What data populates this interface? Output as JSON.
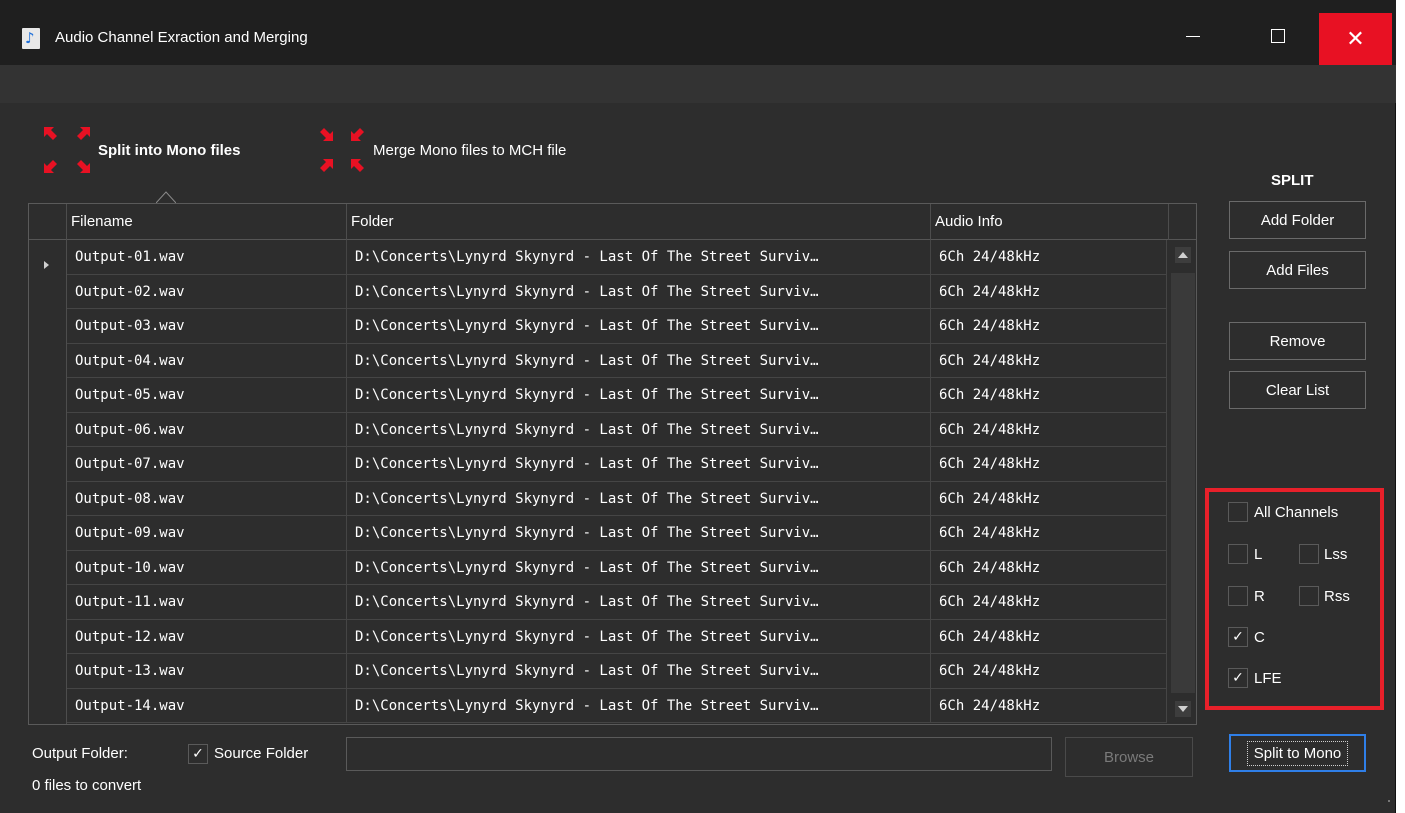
{
  "window": {
    "title": "Audio Channel Exraction and Merging",
    "close_glyph": "✕"
  },
  "icons": {
    "app": "music-note-icon",
    "split": "expand-arrows-icon",
    "merge": "collapse-arrows-icon",
    "accent": "#e81123"
  },
  "modes": {
    "split_label": "Split into Mono files",
    "merge_label": "Merge Mono files to MCH file"
  },
  "grid": {
    "columns": [
      "Filename",
      "Folder",
      "Audio Info"
    ],
    "rows": [
      {
        "filename": "Output-01.wav",
        "folder": "D:\\Concerts\\Lynyrd Skynyrd - Last Of The Street Surviv…",
        "info": "6Ch 24/48kHz"
      },
      {
        "filename": "Output-02.wav",
        "folder": "D:\\Concerts\\Lynyrd Skynyrd - Last Of The Street Surviv…",
        "info": "6Ch 24/48kHz"
      },
      {
        "filename": "Output-03.wav",
        "folder": "D:\\Concerts\\Lynyrd Skynyrd - Last Of The Street Surviv…",
        "info": "6Ch 24/48kHz"
      },
      {
        "filename": "Output-04.wav",
        "folder": "D:\\Concerts\\Lynyrd Skynyrd - Last Of The Street Surviv…",
        "info": "6Ch 24/48kHz"
      },
      {
        "filename": "Output-05.wav",
        "folder": "D:\\Concerts\\Lynyrd Skynyrd - Last Of The Street Surviv…",
        "info": "6Ch 24/48kHz"
      },
      {
        "filename": "Output-06.wav",
        "folder": "D:\\Concerts\\Lynyrd Skynyrd - Last Of The Street Surviv…",
        "info": "6Ch 24/48kHz"
      },
      {
        "filename": "Output-07.wav",
        "folder": "D:\\Concerts\\Lynyrd Skynyrd - Last Of The Street Surviv…",
        "info": "6Ch 24/48kHz"
      },
      {
        "filename": "Output-08.wav",
        "folder": "D:\\Concerts\\Lynyrd Skynyrd - Last Of The Street Surviv…",
        "info": "6Ch 24/48kHz"
      },
      {
        "filename": "Output-09.wav",
        "folder": "D:\\Concerts\\Lynyrd Skynyrd - Last Of The Street Surviv…",
        "info": "6Ch 24/48kHz"
      },
      {
        "filename": "Output-10.wav",
        "folder": "D:\\Concerts\\Lynyrd Skynyrd - Last Of The Street Surviv…",
        "info": "6Ch 24/48kHz"
      },
      {
        "filename": "Output-11.wav",
        "folder": "D:\\Concerts\\Lynyrd Skynyrd - Last Of The Street Surviv…",
        "info": "6Ch 24/48kHz"
      },
      {
        "filename": "Output-12.wav",
        "folder": "D:\\Concerts\\Lynyrd Skynyrd - Last Of The Street Surviv…",
        "info": "6Ch 24/48kHz"
      },
      {
        "filename": "Output-13.wav",
        "folder": "D:\\Concerts\\Lynyrd Skynyrd - Last Of The Street Surviv…",
        "info": "6Ch 24/48kHz"
      },
      {
        "filename": "Output-14.wav",
        "folder": "D:\\Concerts\\Lynyrd Skynyrd - Last Of The Street Surviv…",
        "info": "6Ch 24/48kHz"
      }
    ]
  },
  "output": {
    "label": "Output Folder:",
    "source_folder_label": "Source Folder",
    "source_folder_checked": true,
    "path_value": "",
    "browse_label": "Browse",
    "status": "0 files to convert"
  },
  "panel": {
    "title": "SPLIT",
    "add_folder": "Add Folder",
    "add_files": "Add Files",
    "remove": "Remove",
    "clear_list": "Clear List",
    "split_to_mono": "Split to Mono",
    "highlight_color": "#e8202a",
    "channels": {
      "all": {
        "label": "All Channels",
        "checked": false
      },
      "L": {
        "label": "L",
        "checked": false
      },
      "Lss": {
        "label": "Lss",
        "checked": false
      },
      "R": {
        "label": "R",
        "checked": false
      },
      "Rss": {
        "label": "Rss",
        "checked": false
      },
      "C": {
        "label": "C",
        "checked": true
      },
      "LFE": {
        "label": "LFE",
        "checked": true
      }
    }
  }
}
